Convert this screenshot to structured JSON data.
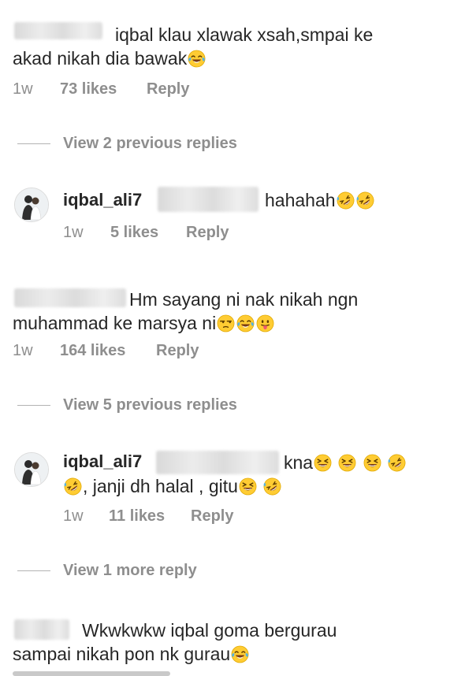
{
  "comments": [
    {
      "text_line1": "iqbal klau xlawak xsah,smpai ke",
      "text_line2": "akad nikah dia bawak",
      "time": "1w",
      "likes": "73 likes",
      "reply": "Reply"
    },
    {
      "text_line1": "Hm sayang ni nak nikah ngn",
      "text_line2": "muhammad ke marsya ni",
      "time": "1w",
      "likes": "164 likes",
      "reply": "Reply"
    },
    {
      "text_line1": "Wkwkwkw iqbal goma bergurau",
      "text_line2": "sampai nikah pon nk gurau"
    }
  ],
  "replies": [
    {
      "username": "iqbal_ali7",
      "text": "hahahah",
      "time": "1w",
      "likes": "5 likes",
      "reply": "Reply"
    },
    {
      "username": "iqbal_ali7",
      "text_line1": "kna",
      "text_line2": ", janji dh halal , gitu",
      "time": "1w",
      "likes": "11 likes",
      "reply": "Reply"
    }
  ],
  "view_replies": {
    "first": "View 2 previous replies",
    "second": "View 5 previous replies",
    "third": "View 1 more reply"
  },
  "icons": {
    "laugh_tears": "face-with-tears-of-joy-icon",
    "rofl": "rolling-on-floor-laughing-icon",
    "unamused": "unamused-face-icon",
    "tongue": "face-with-tongue-icon",
    "squint": "grinning-squinting-face-icon"
  }
}
